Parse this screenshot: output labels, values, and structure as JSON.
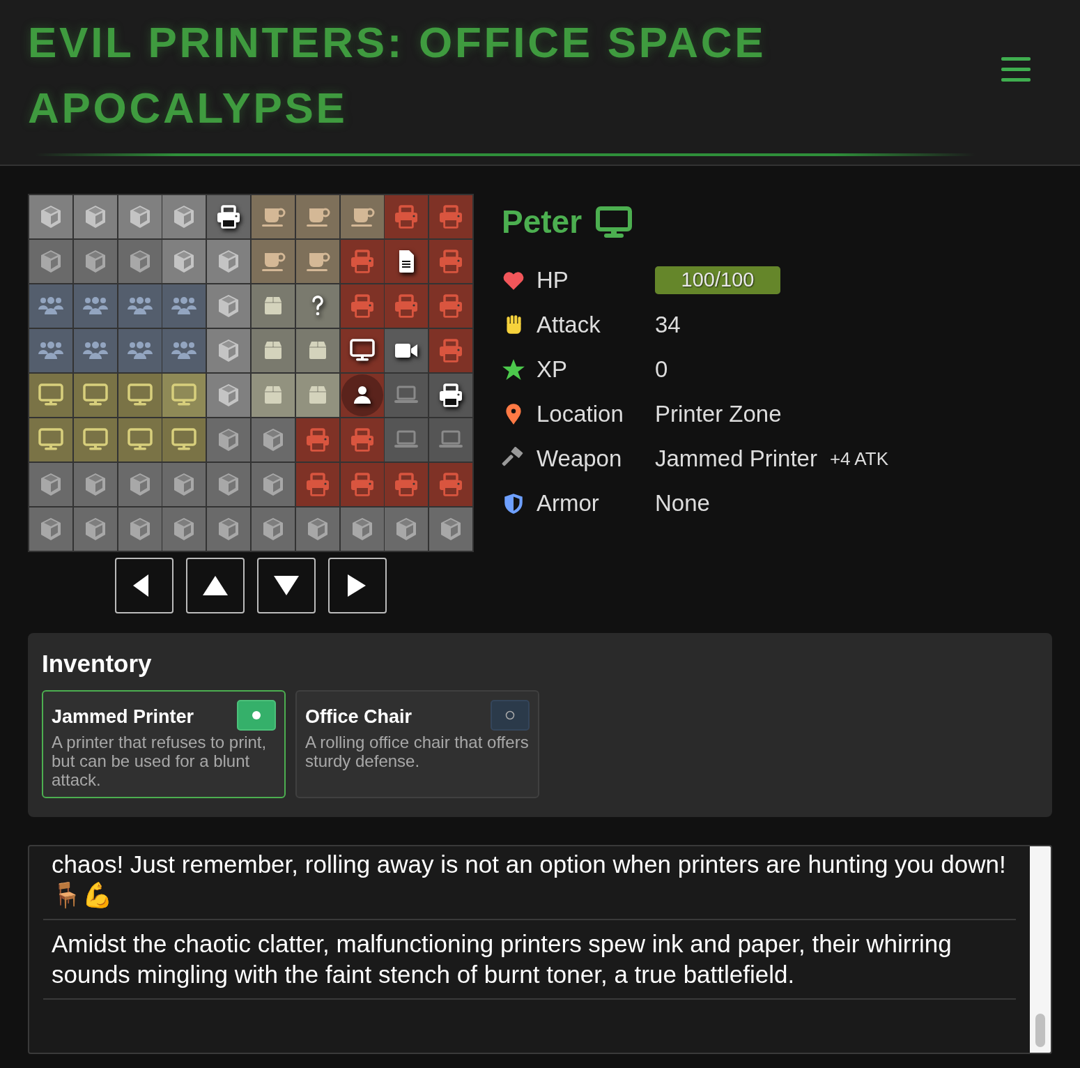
{
  "header": {
    "title": "EVIL PRINTERS: OFFICE SPACE APOCALYPSE"
  },
  "map": {
    "rows": [
      [
        {
          "kind": "cube",
          "color": "#808080"
        },
        {
          "kind": "cube",
          "color": "#808080"
        },
        {
          "kind": "cube",
          "color": "#808080"
        },
        {
          "kind": "cube",
          "color": "#808080"
        },
        {
          "kind": "printer-item",
          "color": "#666666"
        },
        {
          "kind": "coffee",
          "color": "#7e705a"
        },
        {
          "kind": "coffee",
          "color": "#7e705a"
        },
        {
          "kind": "coffee",
          "color": "#7e705a"
        },
        {
          "kind": "printer",
          "color": "#7f3226"
        },
        {
          "kind": "printer",
          "color": "#7f3226"
        }
      ],
      [
        {
          "kind": "cube",
          "color": "#6a6a6a"
        },
        {
          "kind": "cube",
          "color": "#6a6a6a"
        },
        {
          "kind": "cube",
          "color": "#6a6a6a"
        },
        {
          "kind": "cube",
          "color": "#808080"
        },
        {
          "kind": "cube",
          "color": "#808080"
        },
        {
          "kind": "coffee",
          "color": "#7e705a"
        },
        {
          "kind": "coffee",
          "color": "#7e705a"
        },
        {
          "kind": "printer",
          "color": "#7f3226"
        },
        {
          "kind": "document",
          "color": "#7f3226"
        },
        {
          "kind": "printer",
          "color": "#7f3226"
        }
      ],
      [
        {
          "kind": "people",
          "color": "#545e6d"
        },
        {
          "kind": "people",
          "color": "#545e6d"
        },
        {
          "kind": "people",
          "color": "#545e6d"
        },
        {
          "kind": "people",
          "color": "#545e6d"
        },
        {
          "kind": "cube",
          "color": "#808080"
        },
        {
          "kind": "box",
          "color": "#7a7a6e"
        },
        {
          "kind": "question",
          "color": "#7a7a6e"
        },
        {
          "kind": "printer",
          "color": "#7f3226"
        },
        {
          "kind": "printer",
          "color": "#7f3226"
        },
        {
          "kind": "printer",
          "color": "#7f3226"
        }
      ],
      [
        {
          "kind": "people",
          "color": "#545e6d"
        },
        {
          "kind": "people",
          "color": "#545e6d"
        },
        {
          "kind": "people",
          "color": "#545e6d"
        },
        {
          "kind": "people",
          "color": "#545e6d"
        },
        {
          "kind": "cube",
          "color": "#808080"
        },
        {
          "kind": "box",
          "color": "#7a7a6e"
        },
        {
          "kind": "box",
          "color": "#7a7a6e"
        },
        {
          "kind": "monitor-item",
          "color": "#7f3226"
        },
        {
          "kind": "camera",
          "color": "#5a5a5a"
        },
        {
          "kind": "printer",
          "color": "#7f3226"
        }
      ],
      [
        {
          "kind": "monitor",
          "color": "#7a7346"
        },
        {
          "kind": "monitor",
          "color": "#7a7346"
        },
        {
          "kind": "monitor",
          "color": "#7a7346"
        },
        {
          "kind": "monitor",
          "color": "#8f8a57"
        },
        {
          "kind": "cube",
          "color": "#808080"
        },
        {
          "kind": "box",
          "color": "#92927f"
        },
        {
          "kind": "box",
          "color": "#92927f"
        },
        {
          "kind": "player",
          "color": "#7f3226"
        },
        {
          "kind": "laptop",
          "color": "#555555"
        },
        {
          "kind": "printer-item",
          "color": "#555555"
        }
      ],
      [
        {
          "kind": "monitor",
          "color": "#7a7346"
        },
        {
          "kind": "monitor",
          "color": "#7a7346"
        },
        {
          "kind": "monitor",
          "color": "#7a7346"
        },
        {
          "kind": "monitor",
          "color": "#7a7346"
        },
        {
          "kind": "cube",
          "color": "#6a6a6a"
        },
        {
          "kind": "cube",
          "color": "#6a6a6a"
        },
        {
          "kind": "printer",
          "color": "#7f3226"
        },
        {
          "kind": "printer",
          "color": "#7f3226"
        },
        {
          "kind": "laptop",
          "color": "#555555"
        },
        {
          "kind": "laptop",
          "color": "#555555"
        }
      ],
      [
        {
          "kind": "cube",
          "color": "#6a6a6a"
        },
        {
          "kind": "cube",
          "color": "#6a6a6a"
        },
        {
          "kind": "cube",
          "color": "#6a6a6a"
        },
        {
          "kind": "cube",
          "color": "#6a6a6a"
        },
        {
          "kind": "cube",
          "color": "#6a6a6a"
        },
        {
          "kind": "cube",
          "color": "#6a6a6a"
        },
        {
          "kind": "printer",
          "color": "#7f3226"
        },
        {
          "kind": "printer",
          "color": "#7f3226"
        },
        {
          "kind": "printer",
          "color": "#7f3226"
        },
        {
          "kind": "printer",
          "color": "#7f3226"
        }
      ],
      [
        {
          "kind": "cube",
          "color": "#6a6a6a"
        },
        {
          "kind": "cube",
          "color": "#6a6a6a"
        },
        {
          "kind": "cube",
          "color": "#6a6a6a"
        },
        {
          "kind": "cube",
          "color": "#6a6a6a"
        },
        {
          "kind": "cube",
          "color": "#6a6a6a"
        },
        {
          "kind": "cube",
          "color": "#6a6a6a"
        },
        {
          "kind": "cube",
          "color": "#6a6a6a"
        },
        {
          "kind": "cube",
          "color": "#6a6a6a"
        },
        {
          "kind": "cube",
          "color": "#6a6a6a"
        },
        {
          "kind": "cube",
          "color": "#6a6a6a"
        }
      ]
    ],
    "controls": [
      {
        "kind": "left"
      },
      {
        "kind": "up"
      },
      {
        "kind": "down"
      },
      {
        "kind": "right"
      }
    ]
  },
  "character": {
    "name": "Peter",
    "stats": [
      {
        "kind": "hp",
        "label": "HP",
        "value": "100/100",
        "level": 1
      },
      {
        "kind": "attack",
        "label": "Attack",
        "value": "34"
      },
      {
        "kind": "xp",
        "label": "XP",
        "value": "0"
      },
      {
        "kind": "location",
        "label": "Location",
        "value": "Printer Zone"
      },
      {
        "kind": "weapon",
        "label": "Weapon",
        "value": "Jammed Printer",
        "bonus": "+4 ATK"
      },
      {
        "kind": "armor",
        "label": "Armor",
        "value": "None"
      }
    ]
  },
  "inventory": {
    "title": "Inventory",
    "items": [
      {
        "name": "Jammed Printer",
        "description": "A printer that refuses to print, but can be used for a blunt attack.",
        "equipped": true
      },
      {
        "name": "Office Chair",
        "description": "A rolling office chair that offers sturdy defense.",
        "equipped": false
      }
    ]
  },
  "log": [
    "chaos! Just remember, rolling away is not an option when printers are hunting you down! 🪑💪",
    "Amidst the chaotic clatter, malfunctioning printers spew ink and paper, their whirring sounds mingling with the faint stench of burnt toner, a true battlefield."
  ]
}
